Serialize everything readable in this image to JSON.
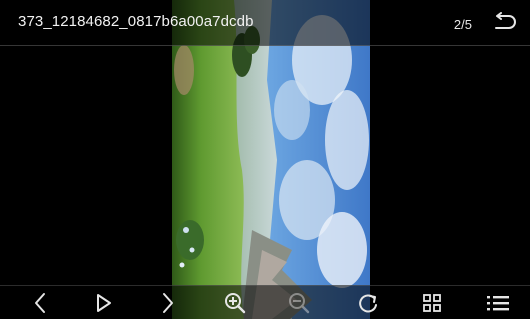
{
  "header": {
    "title": "373_12184682_0817b6a00a7dcdb",
    "counter": "2/5",
    "back_icon": "return-arrow-icon"
  },
  "viewer": {
    "image_content": "landscape photo rotated: green grass hill, blue sky with clouds, mountains"
  },
  "toolbar": {
    "items": [
      {
        "icon": "chevron-left-icon",
        "enabled": true
      },
      {
        "icon": "play-icon",
        "enabled": true
      },
      {
        "icon": "chevron-right-icon",
        "enabled": true
      },
      {
        "icon": "zoom-in-icon",
        "enabled": true
      },
      {
        "icon": "zoom-out-icon",
        "enabled": false
      },
      {
        "icon": "rotate-icon",
        "enabled": true
      },
      {
        "icon": "grid-view-icon",
        "enabled": true
      },
      {
        "icon": "list-view-icon",
        "enabled": true
      }
    ]
  },
  "colors": {
    "icon": "#e6e6e6",
    "sky": "#5b95d8",
    "grass": "#4e8a2a"
  }
}
